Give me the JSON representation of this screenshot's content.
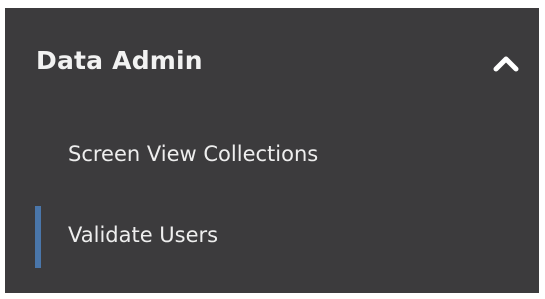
{
  "section": {
    "title": "Data Admin",
    "icon": "chevron-up-icon",
    "expanded": true
  },
  "items": [
    {
      "label": "Screen View Collections",
      "active": false
    },
    {
      "label": "Validate Users",
      "active": true
    }
  ],
  "colors": {
    "panel_background": "#3c3b3d",
    "text": "#eeeeee",
    "active_indicator": "#4a76aa"
  }
}
